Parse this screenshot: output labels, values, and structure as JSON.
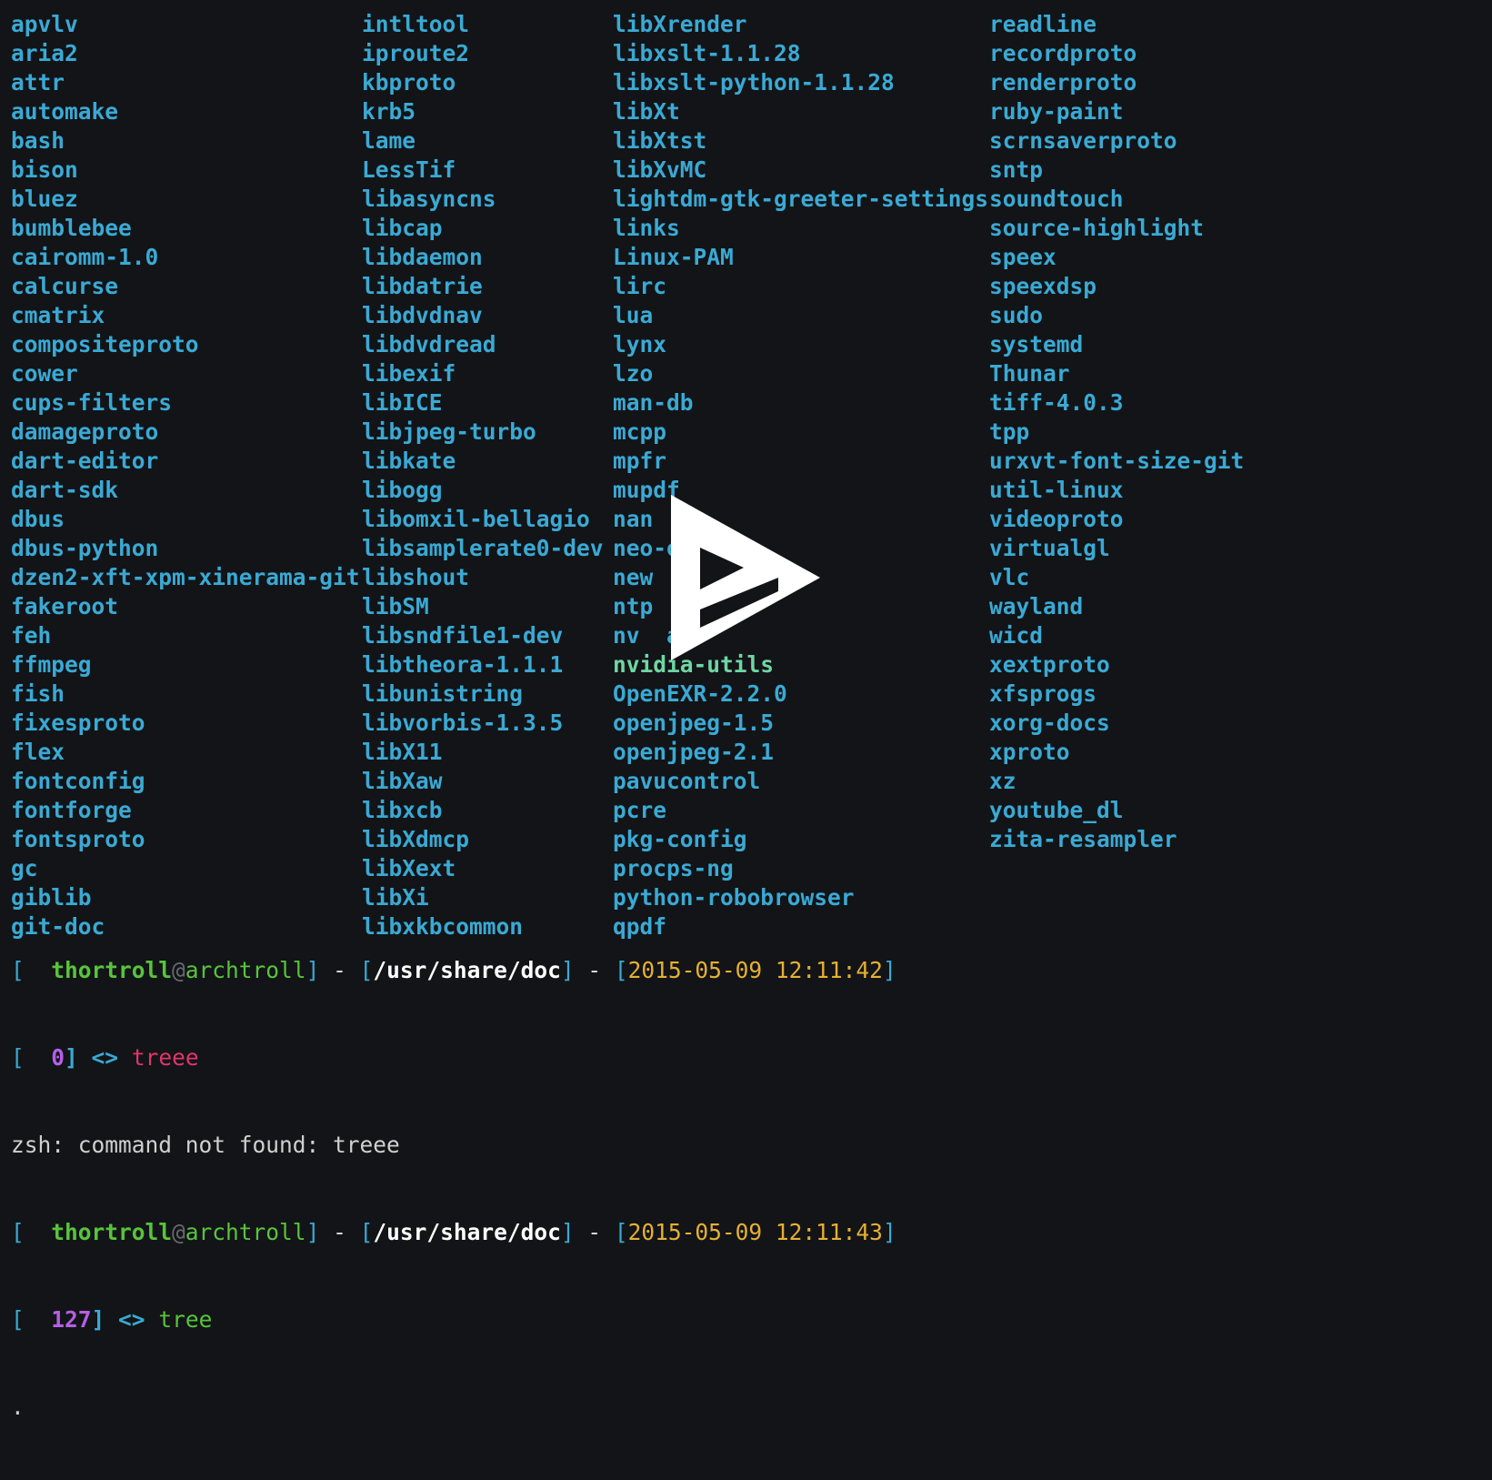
{
  "listing": {
    "col1": [
      "apvlv",
      "aria2",
      "attr",
      "automake",
      "bash",
      "bison",
      "bluez",
      "bumblebee",
      "cairomm-1.0",
      "calcurse",
      "cmatrix",
      "compositeproto",
      "cower",
      "cups-filters",
      "damageproto",
      "dart-editor",
      "dart-sdk",
      "dbus",
      "dbus-python",
      "dzen2-xft-xpm-xinerama-git",
      "fakeroot",
      "feh",
      "ffmpeg",
      "fish",
      "fixesproto",
      "flex",
      "fontconfig",
      "fontforge",
      "fontsproto",
      "gc",
      "giblib",
      "git-doc"
    ],
    "col2": [
      "intltool",
      "iproute2",
      "kbproto",
      "krb5",
      "lame",
      "LessTif",
      "libasyncns",
      "libcap",
      "libdaemon",
      "libdatrie",
      "libdvdnav",
      "libdvdread",
      "libexif",
      "libICE",
      "libjpeg-turbo",
      "libkate",
      "libogg",
      "libomxil-bellagio",
      "libsamplerate0-dev",
      "libshout",
      "libSM",
      "libsndfile1-dev",
      "libtheora-1.1.1",
      "libunistring",
      "libvorbis-1.3.5",
      "libX11",
      "libXaw",
      "libxcb",
      "libXdmcp",
      "libXext",
      "libXi",
      "libxkbcommon"
    ],
    "col3": [
      "libXrender",
      "libxslt-1.1.28",
      "libxslt-python-1.1.28",
      "libXt",
      "libXtst",
      "libXvMC",
      "lightdm-gtk-greeter-settings",
      "links",
      "Linux-PAM",
      "lirc",
      "lua",
      "lynx",
      "lzo",
      "man-db",
      "mcpp",
      "mpfr",
      "mupdf",
      "nan",
      "neo-o  1",
      "new  le",
      "ntp",
      "nv  a",
      "nvidia-utils",
      "OpenEXR-2.2.0",
      "openjpeg-1.5",
      "openjpeg-2.1",
      "pavucontrol",
      "pcre",
      "pkg-config",
      "procps-ng",
      "python-robobrowser",
      "qpdf"
    ],
    "col4": [
      "readline",
      "recordproto",
      "renderproto",
      "ruby-paint",
      "scrnsaverproto",
      "sntp",
      "soundtouch",
      "source-highlight",
      "speex",
      "speexdsp",
      "sudo",
      "systemd",
      "Thunar",
      "tiff-4.0.3",
      "tpp",
      "urxvt-font-size-git",
      "util-linux",
      "videoproto",
      "virtualgl",
      "vlc",
      "wayland",
      "wicd",
      "xextproto",
      "xfsprogs",
      "xorg-docs",
      "xproto",
      "xz",
      "youtube_dl",
      "zita-resampler"
    ]
  },
  "prompt1": {
    "open": "[  ",
    "user": "thortroll",
    "at": "@",
    "host": "archtroll",
    "close": "]",
    "sep": " - ",
    "path_open": "[",
    "path": "/usr/share/doc",
    "path_close": "]",
    "sep2": " - ",
    "ts_open": "[",
    "timestamp": "2015-05-09 12:11:42",
    "ts_close": "]"
  },
  "status1": {
    "open": "[  ",
    "code": "0",
    "close": "]",
    "arrow": " <> ",
    "command": "treee"
  },
  "error_line": "zsh: command not found: treee",
  "prompt2": {
    "open": "[  ",
    "user": "thortroll",
    "at": "@",
    "host": "archtroll",
    "close": "]",
    "sep": " - ",
    "path_open": "[",
    "path": "/usr/share/doc",
    "path_close": "]",
    "sep2": " - ",
    "ts_open": "[",
    "timestamp": "2015-05-09 12:11:43",
    "ts_close": "]"
  },
  "status2": {
    "open": "[  ",
    "code": "127",
    "close": "]",
    "arrow": " <> ",
    "command": "tree"
  },
  "output_last": ".",
  "colors": {
    "background": "#121417",
    "dir": "#3aa9d4",
    "exec": "#6fd6a4"
  },
  "overlay": {
    "icon": "play-icon"
  }
}
